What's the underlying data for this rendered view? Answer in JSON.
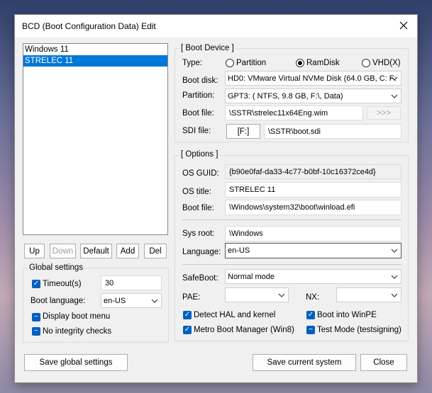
{
  "window": {
    "title": "BCD (Boot Configuration Data) Edit"
  },
  "entries": [
    "Windows 11",
    "STRELEC 11"
  ],
  "entry_buttons": {
    "up": "Up",
    "down": "Down",
    "default": "Default",
    "add": "Add",
    "del": "Del"
  },
  "global_settings": {
    "title": "Global settings",
    "timeout_label": "Timeout(s)",
    "timeout_value": "30",
    "boot_language_label": "Boot language:",
    "boot_language_value": "en-US",
    "display_boot_menu": "Display boot menu",
    "no_integrity_checks": "No integrity checks"
  },
  "boot_device": {
    "title": "[ Boot Device ]",
    "type_label": "Type:",
    "type_options": [
      "Partition",
      "RamDisk",
      "VHD(X)"
    ],
    "boot_disk_label": "Boot disk:",
    "boot_disk_value": "HD0: VMware Virtual NVMe Disk (64.0 GB, C: F:",
    "partition_label": "Partition:",
    "partition_value": "GPT3: ( NTFS,   9.8 GB, F:\\, Data)",
    "boot_file_label": "Boot file:",
    "boot_file_value": "\\SSTR\\strelec11x64Eng.wim",
    "browse_label": ">>>",
    "sdi_file_label": "SDI file:",
    "sdi_drive": "[F:]",
    "sdi_path": "\\SSTR\\boot.sdi"
  },
  "options": {
    "title": "[ Options ]",
    "os_guid_label": "OS GUID:",
    "os_guid_value": "{b90e0faf-da33-4c77-b0bf-10c16372ce4d}",
    "os_title_label": "OS title:",
    "os_title_value": "STRELEC 11",
    "boot_file_label": "Boot file:",
    "boot_file_value": "\\Windows\\system32\\boot\\winload.efi",
    "sys_root_label": "Sys root:",
    "sys_root_value": "\\Windows",
    "language_label": "Language:",
    "language_value": "en-US",
    "safeboot_label": "SafeBoot:",
    "safeboot_value": "Normal mode",
    "pae_label": "PAE:",
    "nx_label": "NX:",
    "detect_hal": "Detect HAL and kernel",
    "boot_into_winpe": "Boot into WinPE",
    "metro_boot_manager": "Metro Boot Manager (Win8)",
    "test_mode": "Test Mode (testsigning)"
  },
  "footer": {
    "save_global": "Save global settings",
    "save_current": "Save current system",
    "close": "Close"
  },
  "colors": {
    "selection": "#0078d7",
    "checkbox": "#0060c0",
    "dialog": "#f0f0f0"
  }
}
